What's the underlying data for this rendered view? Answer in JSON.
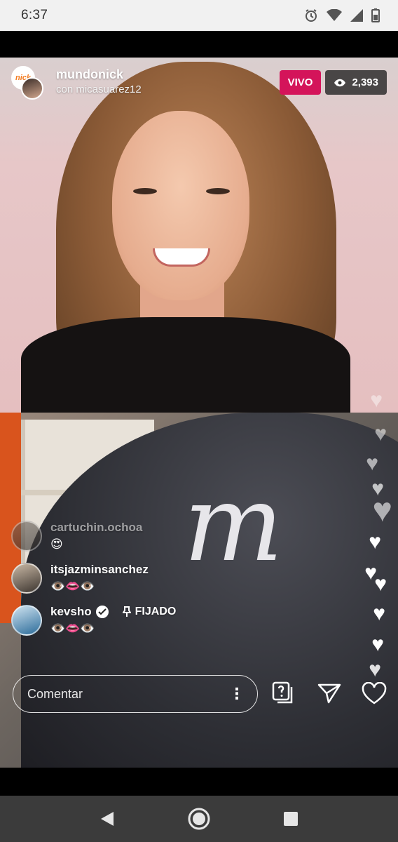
{
  "status_bar": {
    "time": "6:37",
    "icons": [
      "alarm-icon",
      "wifi-icon",
      "cell-signal-icon",
      "battery-icon"
    ]
  },
  "live": {
    "host_username": "mundonick",
    "host_avatar_text": "nick",
    "guest_line": "con micasuarez12",
    "live_label": "VIVO",
    "viewer_count": "2,393",
    "colors": {
      "live_badge": "#d4145a",
      "viewer_badge": "#282828"
    }
  },
  "comments": [
    {
      "username": "cartuchin.ochoa",
      "text": "😍",
      "faded": true
    },
    {
      "username": "itsjazminsanchez",
      "text": "👁️👄👁️"
    },
    {
      "username": "kevsho",
      "text": "👁️👄👁️",
      "verified": true,
      "pinned_label": "FIJADO"
    }
  ],
  "composer": {
    "placeholder": "Comentar",
    "buttons": [
      "question-box-icon",
      "send-icon",
      "heart-icon"
    ]
  },
  "nav": {
    "buttons": [
      "back-icon",
      "home-icon",
      "recents-icon"
    ]
  }
}
